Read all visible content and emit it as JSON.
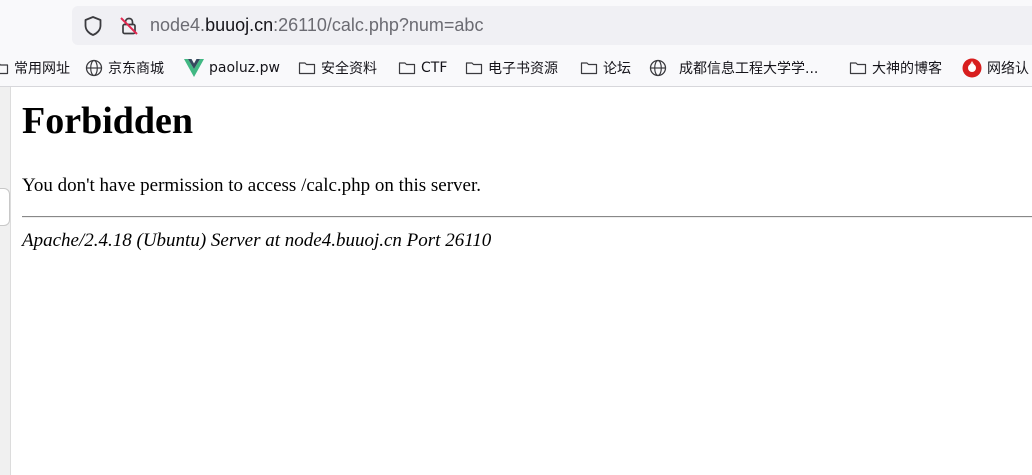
{
  "address_bar": {
    "url_host_prefix": "node4.",
    "url_domain": "buuoj.cn",
    "url_suffix": ":26110/calc.php?num=abc"
  },
  "bookmarks": [
    {
      "label": "常用网址",
      "icon": "folder-icon"
    },
    {
      "label": "京东商城",
      "icon": "globe-icon"
    },
    {
      "label": "paoluz.pw",
      "icon": "vue-logo-icon"
    },
    {
      "label": "安全资料",
      "icon": "folder-icon"
    },
    {
      "label": "CTF",
      "icon": "folder-icon"
    },
    {
      "label": "电子书资源",
      "icon": "folder-icon"
    },
    {
      "label": "论坛",
      "icon": "folder-icon"
    },
    {
      "label": "成都信息工程大学学...",
      "icon": "globe-icon"
    },
    {
      "label": "大神的博客",
      "icon": "folder-icon"
    },
    {
      "label": "网络认",
      "icon": "red-logo-icon"
    }
  ],
  "page": {
    "heading": "Forbidden",
    "message": "You don't have permission to access /calc.php on this server.",
    "server_signature": "Apache/2.4.18 (Ubuntu) Server at node4.buuoj.cn Port 26110"
  },
  "colors": {
    "chrome_bg": "#f9f9fb",
    "urlbar_bg": "#f0f0f4",
    "url_dim_text": "#6b6b72",
    "vue_green": "#41b883",
    "vue_dark": "#35495e",
    "red_logo": "#d81e1e"
  }
}
